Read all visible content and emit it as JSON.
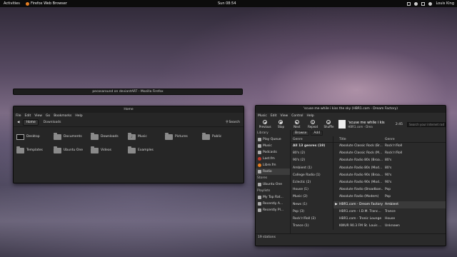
{
  "topbar": {
    "activities": "Activities",
    "app_name": "Firefox Web Browser",
    "clock": "Sun 08:54",
    "user": "Louis King"
  },
  "firefox": {
    "title": "pecosaround on deviantART - Mozilla Firefox"
  },
  "nautilus": {
    "title": "Home",
    "menu": [
      "File",
      "Edit",
      "View",
      "Go",
      "Bookmarks",
      "Help"
    ],
    "crumbs": [
      "Home",
      "Downloads"
    ],
    "search_label": "Search",
    "folders": [
      "Desktop",
      "Documents",
      "Downloads",
      "Music",
      "Pictures",
      "Public",
      "Templates",
      "Ubuntu One",
      "Videos",
      "Examples"
    ]
  },
  "rhythmbox": {
    "title": "'scuse me while i kiss the sky (HBR1.com - Dream Factory)",
    "menu": [
      "Music",
      "Edit",
      "View",
      "Control",
      "Help"
    ],
    "controls": [
      "Previous",
      "Stop",
      "Next",
      "Repeat",
      "Shuffle"
    ],
    "now_playing_title": "'scuse me while i kis",
    "now_playing_sub": "HBR1.com - Drea",
    "elapsed": "2:45",
    "search_placeholder": "Search your internet rad",
    "library_header": "Library",
    "library": [
      "Play Queue",
      "Music",
      "Podcasts",
      "Last.fm",
      "Libre.fm",
      "Radio"
    ],
    "stores_header": "Stores",
    "stores": [
      "Ubuntu One"
    ],
    "playlists_header": "Playlists",
    "playlists": [
      "My Top Rat...",
      "Recently A...",
      "Recently Pl..."
    ],
    "tabs": [
      "Browse",
      "Add"
    ],
    "genre_header": "Genre",
    "genres": [
      "All 13 genres (19)",
      "80's (2)",
      "90's (2)",
      "Ambient (1)",
      "College Radio (1)",
      "Eclectic (2)",
      "House (1)",
      "Music (2)",
      "News (1)",
      "Pop (3)",
      "Rock'n'Roll (2)",
      "Trance (1)"
    ],
    "col_title": "Title",
    "col_genre": "Genre",
    "stations": [
      {
        "title": "Absolute Classic Rock (Br...",
        "genre": "Rock'n'Roll"
      },
      {
        "title": "Absolute Classic Rock (M...",
        "genre": "Rock'n'Roll"
      },
      {
        "title": "Absolute Radio 80s (Broa...",
        "genre": "80's"
      },
      {
        "title": "Absolute Radio 80s (Mod...",
        "genre": "80's"
      },
      {
        "title": "Absolute Radio 90s (Broa...",
        "genre": "90's"
      },
      {
        "title": "Absolute Radio 90s (Mod...",
        "genre": "90's"
      },
      {
        "title": "Absolute Radio (Broadban...",
        "genre": "Pop"
      },
      {
        "title": "Absolute Radio (Modem)",
        "genre": "Pop"
      },
      {
        "title": "HBR1.com - Dream Factory",
        "genre": "Ambient"
      },
      {
        "title": "HBR1.com - I.D.M. Tranc...",
        "genre": "Trance"
      },
      {
        "title": "HBR1.com - Tronic Lounge",
        "genre": "House"
      },
      {
        "title": "KWUR 90.3 FM St. Louis ...",
        "genre": "Unknown"
      }
    ],
    "status": "19 stations"
  }
}
